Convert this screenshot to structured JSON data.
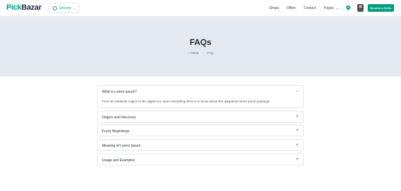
{
  "header": {
    "logo_part1": "Pick",
    "logo_part2": "Bazar",
    "shop_type": "Grocery",
    "nav": [
      "Shops",
      "Offers",
      "Contact",
      "Pages"
    ],
    "seller_button": "Become a Seller",
    "accent_color": "#009f7f"
  },
  "hero": {
    "title": "FAQs",
    "breadcrumb_home": "Home",
    "breadcrumb_current": "FAQ"
  },
  "faq": [
    {
      "question": "What is Lorem Ipsum?",
      "expanded": true,
      "toggle": "−",
      "answer": "From its medieval origins to the digital era, learn everything there is to know about the ubiquitous lorem ipsum passage."
    },
    {
      "question": "Origins and Discovery",
      "expanded": false,
      "toggle": "+"
    },
    {
      "question": "Fuzzy Beginnings",
      "expanded": false,
      "toggle": "+"
    },
    {
      "question": "Meaning of Lorem Ipsum",
      "expanded": false,
      "toggle": "+"
    },
    {
      "question": "Usage and Examples",
      "expanded": false,
      "toggle": "+"
    }
  ]
}
